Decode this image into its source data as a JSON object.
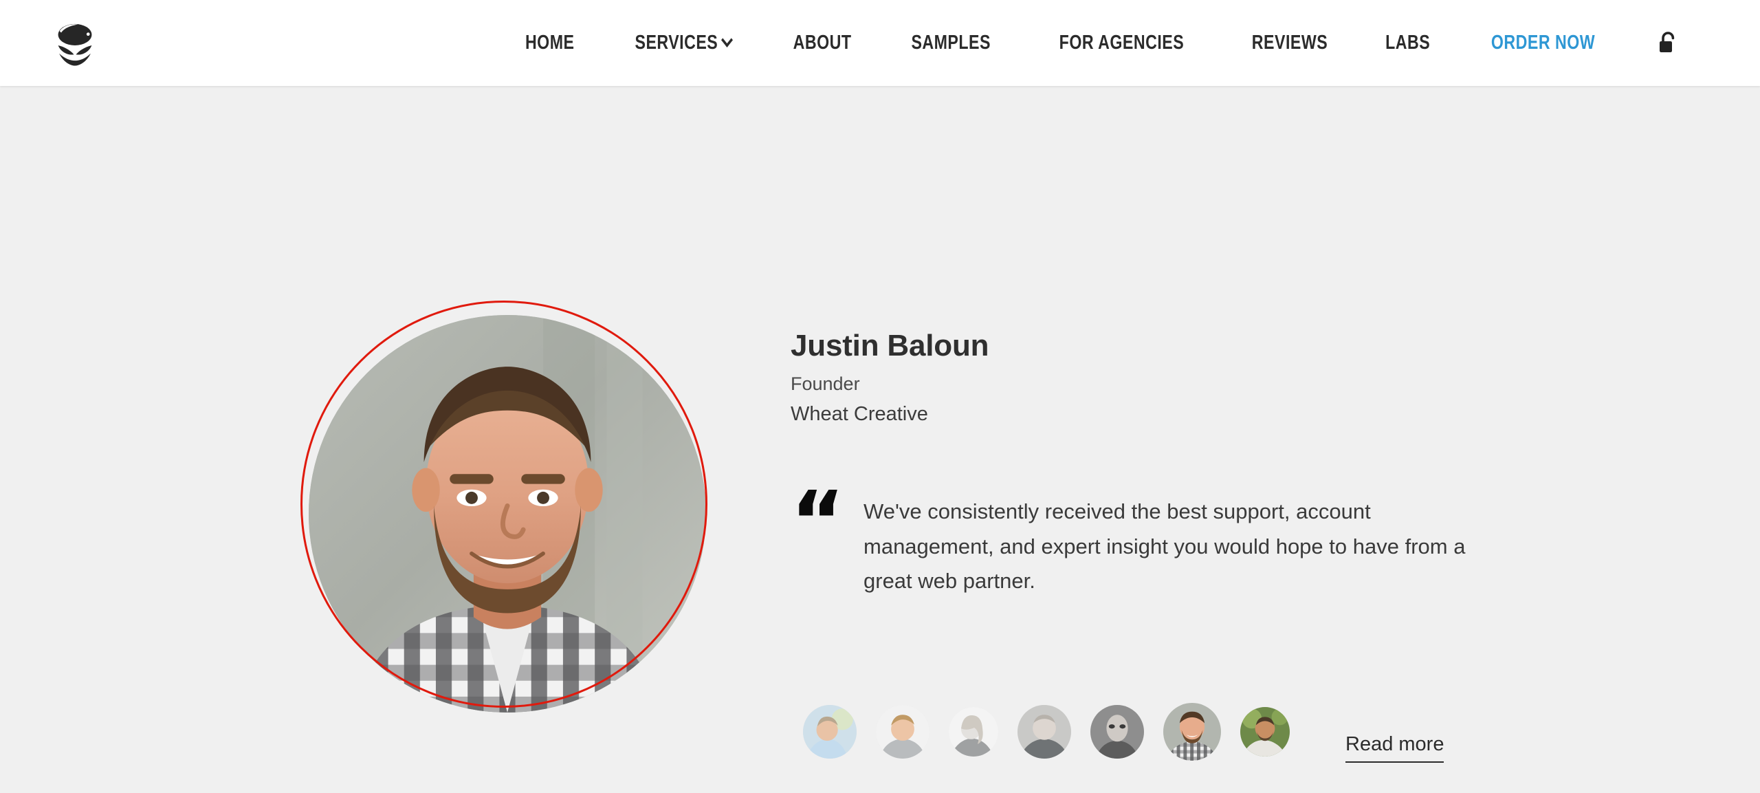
{
  "header": {
    "logo_icon": "wheat-seed-logo",
    "nav": [
      {
        "label": "HOME",
        "accent": false,
        "caret": false
      },
      {
        "label": "SERVICES",
        "accent": false,
        "caret": true
      },
      {
        "label": "ABOUT",
        "accent": false,
        "caret": false
      },
      {
        "label": "SAMPLES",
        "accent": false,
        "caret": false
      },
      {
        "label": "FOR AGENCIES",
        "accent": false,
        "caret": false
      },
      {
        "label": "REVIEWS",
        "accent": false,
        "caret": false
      },
      {
        "label": "LABS",
        "accent": false,
        "caret": false
      },
      {
        "label": "ORDER NOW",
        "accent": true,
        "caret": false
      }
    ],
    "account_icon": "unlock-padlock-icon",
    "accent_color": "#2e97d4",
    "text_color": "#2b2b2b",
    "background": "#ffffff"
  },
  "testimonial": {
    "portrait_alt": "Justin Baloun portrait",
    "portrait_ring_color": "#e01a0d",
    "name": "Justin Baloun",
    "role": "Founder",
    "organization": "Wheat Creative",
    "quote_mark": "“",
    "quote": "We've consistently received the best support, account management, and expert insight you would hope to have from a great web partner.",
    "read_more_label": "Read more",
    "thumbnails": [
      {
        "alt": "testimonial avatar 1",
        "active": false
      },
      {
        "alt": "testimonial avatar 2",
        "active": false
      },
      {
        "alt": "testimonial avatar 3",
        "active": false
      },
      {
        "alt": "testimonial avatar 4",
        "active": false
      },
      {
        "alt": "testimonial avatar 5",
        "active": false
      },
      {
        "alt": "testimonial avatar 6 Justin Baloun",
        "active": true
      },
      {
        "alt": "testimonial avatar 7",
        "active": false
      }
    ]
  },
  "page": {
    "background": "#f0f0f0"
  }
}
